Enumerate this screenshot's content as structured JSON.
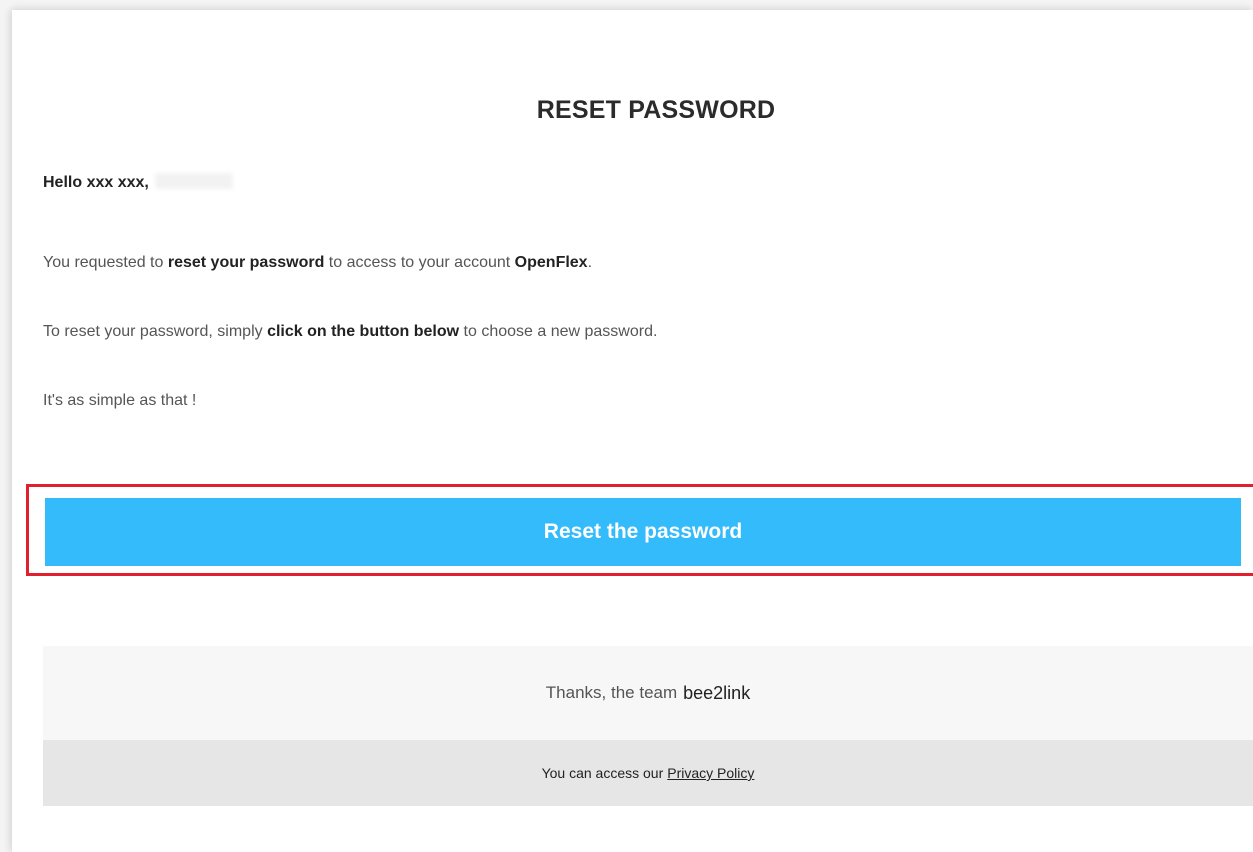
{
  "email": {
    "title": "RESET PASSWORD",
    "greeting": "Hello xxx xxx,",
    "paragraph1": {
      "before": "You requested to ",
      "bold1": "reset your password",
      "middle": " to access to your account ",
      "bold2": "OpenFlex",
      "after": "."
    },
    "paragraph2": {
      "before": "To reset your password, simply ",
      "bold": "click on the button below",
      "after": " to choose a new password."
    },
    "paragraph3": "It's as simple as that !",
    "button_label": "Reset the password",
    "thanks_text": "Thanks, the team",
    "brand": "bee2link",
    "footer_text": "You can access our",
    "privacy_link": "Privacy Policy"
  },
  "colors": {
    "button": "#33bbfb",
    "highlight": "#e0202f",
    "thanks_bg": "#f7f7f7",
    "footer_bg": "#e6e6e6"
  }
}
